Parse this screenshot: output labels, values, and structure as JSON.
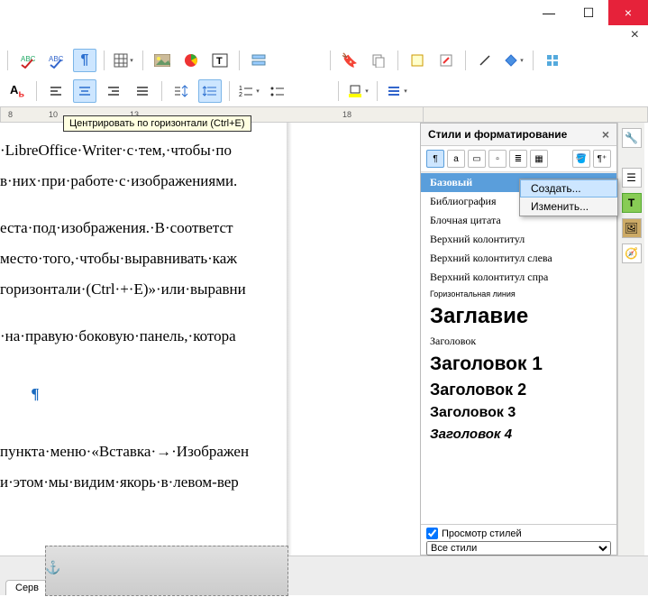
{
  "window": {
    "minimize": "—",
    "maximize": "☐",
    "close": "×",
    "subclose": "×"
  },
  "tooltip": "Центрировать по горизонтали (Ctrl+E)",
  "ruler": {
    "marks": [
      "8",
      "10",
      "13",
      "18"
    ]
  },
  "document": {
    "lines": [
      "·LibreOffice·Writer·с·тем,·чтобы·по",
      "в·них·при·работе·с·изображениями.",
      "",
      "еста·под·изображения.·В·соответст",
      "место·того,·чтобы·выравнивать·каж",
      "горизонтали·(Ctrl·+·E)»·или·выравни",
      "",
      "·на·правую·боковую·панель,·котора",
      "",
      "¶",
      "",
      "пункта·меню·«Вставка·→·Изображен",
      "и·этом·мы·видим·якорь·в·левом-вер"
    ]
  },
  "stylesPanel": {
    "title": "Стили и форматирование",
    "items": [
      {
        "label": "Базовый",
        "cls": "sel"
      },
      {
        "label": "Библиография",
        "cls": ""
      },
      {
        "label": "Блочная цитата",
        "cls": ""
      },
      {
        "label": "Верхний колонтитул",
        "cls": ""
      },
      {
        "label": "Верхний колонтитул слева",
        "cls": ""
      },
      {
        "label": "Верхний колонтитул спра",
        "cls": ""
      },
      {
        "label": "Горизонтальная линия",
        "cls": "small"
      },
      {
        "label": "Заглавие",
        "cls": "big"
      },
      {
        "label": "Заголовок",
        "cls": ""
      },
      {
        "label": "Заголовок 1",
        "cls": "h1"
      },
      {
        "label": "Заголовок 2",
        "cls": "h2"
      },
      {
        "label": "Заголовок 3",
        "cls": "h3"
      },
      {
        "label": "Заголовок 4",
        "cls": "h4"
      }
    ],
    "preview": "Просмотр стилей",
    "filter": "Все стили"
  },
  "contextMenu": {
    "create": "Создать...",
    "edit": "Изменить..."
  },
  "bottomTab": "Серв",
  "icons": {
    "spellcheck": "ABC",
    "pilcrow": "¶",
    "table": "▦",
    "image": "🖼",
    "chart": "●",
    "textbox": "T",
    "section": "≔",
    "bookmark": "🔖",
    "copy": "⧉",
    "note": "📝",
    "edit": "✎",
    "line": "╱",
    "diamond": "◆",
    "grid": "⊞",
    "Ab": "Аⱼ",
    "alignL": "≡",
    "alignC": "≡",
    "alignR": "≡",
    "alignJ": "≡",
    "vcenter": "⇕",
    "list1": "1≡",
    "list2": "≣",
    "colorbox": "▭",
    "para": "≡"
  }
}
